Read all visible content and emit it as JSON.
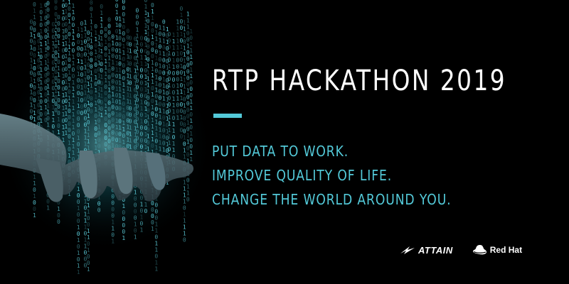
{
  "banner": {
    "title": "RTP HACKATHON 2019",
    "taglines": [
      "PUT DATA TO WORK.",
      "IMPROVE QUALITY OF LIFE.",
      "CHANGE THE WORLD AROUND YOU."
    ],
    "colors": {
      "background": "#000000",
      "title": "#ffffff",
      "accent": "#53c9d8"
    }
  },
  "logos": {
    "attain": {
      "text": "ATTAIN",
      "icon": "attain-swoosh-icon"
    },
    "redhat": {
      "text": "Red Hat",
      "icon": "redhat-hat-icon"
    }
  },
  "art": {
    "subject": "hand-with-binary-rain-image"
  }
}
